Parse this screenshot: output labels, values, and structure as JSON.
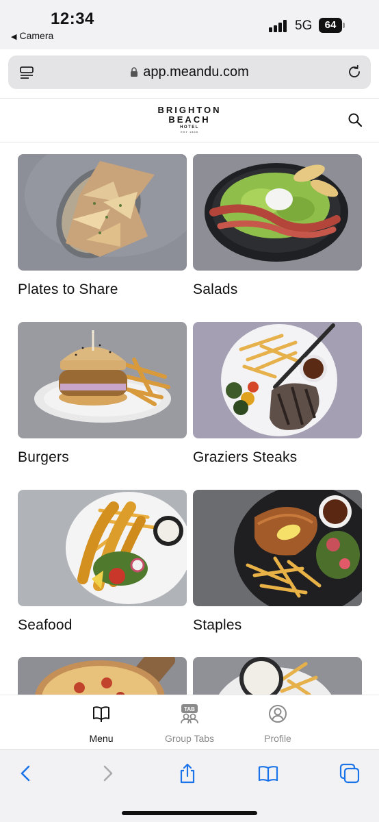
{
  "status": {
    "time": "12:34",
    "back_app": "Camera",
    "network": "5G",
    "battery": "64"
  },
  "browser": {
    "url": "app.meandu.com"
  },
  "site": {
    "logo_line1": "BRIGHTON",
    "logo_line2": "BEACH",
    "logo_line3": "HOTEL",
    "logo_line4": "EST 1868"
  },
  "menu": {
    "categories": [
      {
        "label": "Plates to Share"
      },
      {
        "label": "Salads"
      },
      {
        "label": "Burgers"
      },
      {
        "label": "Graziers Steaks"
      },
      {
        "label": "Seafood"
      },
      {
        "label": "Staples"
      },
      {
        "label": ""
      },
      {
        "label": ""
      }
    ]
  },
  "tabs": [
    {
      "label": "Menu",
      "icon": "book-icon",
      "active": true
    },
    {
      "label": "Group Tabs",
      "icon": "group-tab-icon",
      "badge": "TAB"
    },
    {
      "label": "Profile",
      "icon": "profile-icon"
    }
  ],
  "toolbar": {
    "items": [
      "back-icon",
      "forward-icon",
      "share-icon",
      "bookmarks-icon",
      "tabs-icon"
    ]
  },
  "colors": {
    "safari_blue": "#1a73e8",
    "text": "#111111",
    "muted": "#8a8a8a"
  }
}
